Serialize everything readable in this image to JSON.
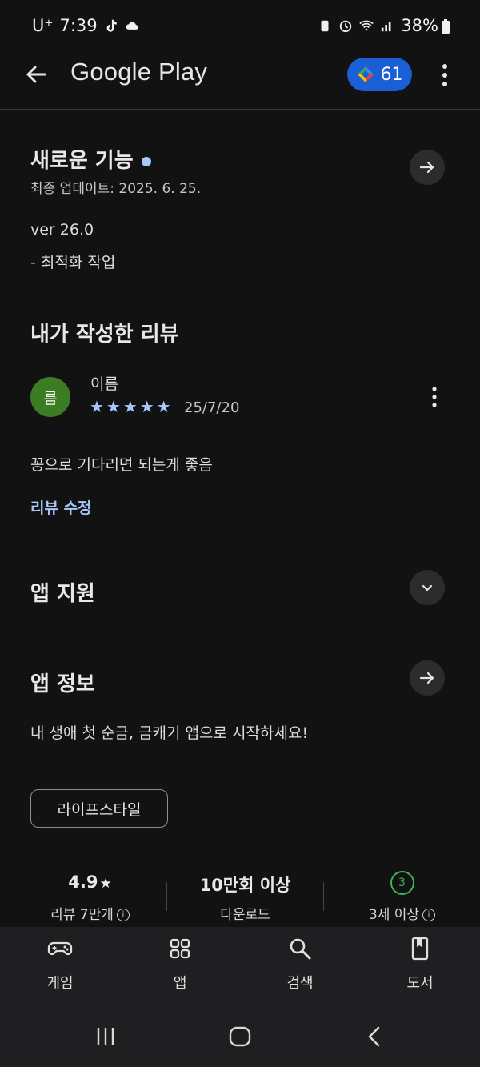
{
  "status_bar": {
    "carrier": "U⁺",
    "time": "7:39",
    "battery": "38%"
  },
  "app_bar": {
    "title": "Google Play",
    "points": "61"
  },
  "whats_new": {
    "title": "새로운 기능",
    "updated": "최종 업데이트: 2025. 6. 25.",
    "version": "ver 26.0",
    "note": "- 최적화 작업"
  },
  "my_review": {
    "title": "내가 작성한 리뷰",
    "avatar_text": "름",
    "user_name": "이름",
    "stars": "★★★★★",
    "rating": 5,
    "date": "25/7/20",
    "text": "꽁으로 기다리면 되는게 좋음",
    "edit_label": "리뷰 수정"
  },
  "app_support": {
    "title": "앱 지원"
  },
  "app_info": {
    "title": "앱 정보",
    "description": "내 생애 첫 순금, 금캐기 앱으로 시작하세요!",
    "category_chip": "라이프스타일"
  },
  "stats": {
    "rating_value": "4.9",
    "rating_star": "★",
    "reviews_label": "리뷰 7만개",
    "downloads_value": "10만회 이상",
    "downloads_label": "다운로드",
    "age_badge": "3",
    "age_label": "3세 이상"
  },
  "bottom_nav": {
    "items": [
      {
        "label": "게임",
        "icon": "gamepad-icon"
      },
      {
        "label": "앱",
        "icon": "apps-grid-icon"
      },
      {
        "label": "검색",
        "icon": "search-icon"
      },
      {
        "label": "도서",
        "icon": "book-icon"
      }
    ]
  },
  "colors": {
    "background": "#121212",
    "accent": "#a8c7fa",
    "points_badge": "#1a5fd6",
    "avatar": "#3c7d23",
    "age_badge": "#3db157"
  }
}
